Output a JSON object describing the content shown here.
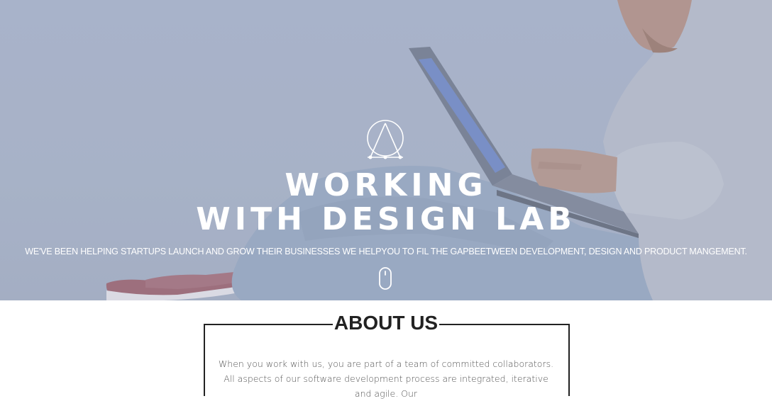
{
  "hero": {
    "headline_line1": "WORKING",
    "headline_line2": "WITH DESIGN LAB",
    "tagline": "WE'VE BEEN HELPING STARTUPS LAUNCH AND GROW THEIR BUSINESSES WE HELPYOU TO FIL THE GAPBEETWEEN DEVELOPMENT, DESIGN AND PRODUCT MANGEMENT.",
    "logo_icon": "triangle-circle-logo-icon",
    "scroll_icon": "mouse-scroll-icon",
    "overlay_color": "#a8b3c8"
  },
  "about": {
    "title": "ABOUT US",
    "text": "When you work with us, you are part of a team of committed collaborators. All aspects of our software development process are integrated, iterative and agile. Our"
  }
}
